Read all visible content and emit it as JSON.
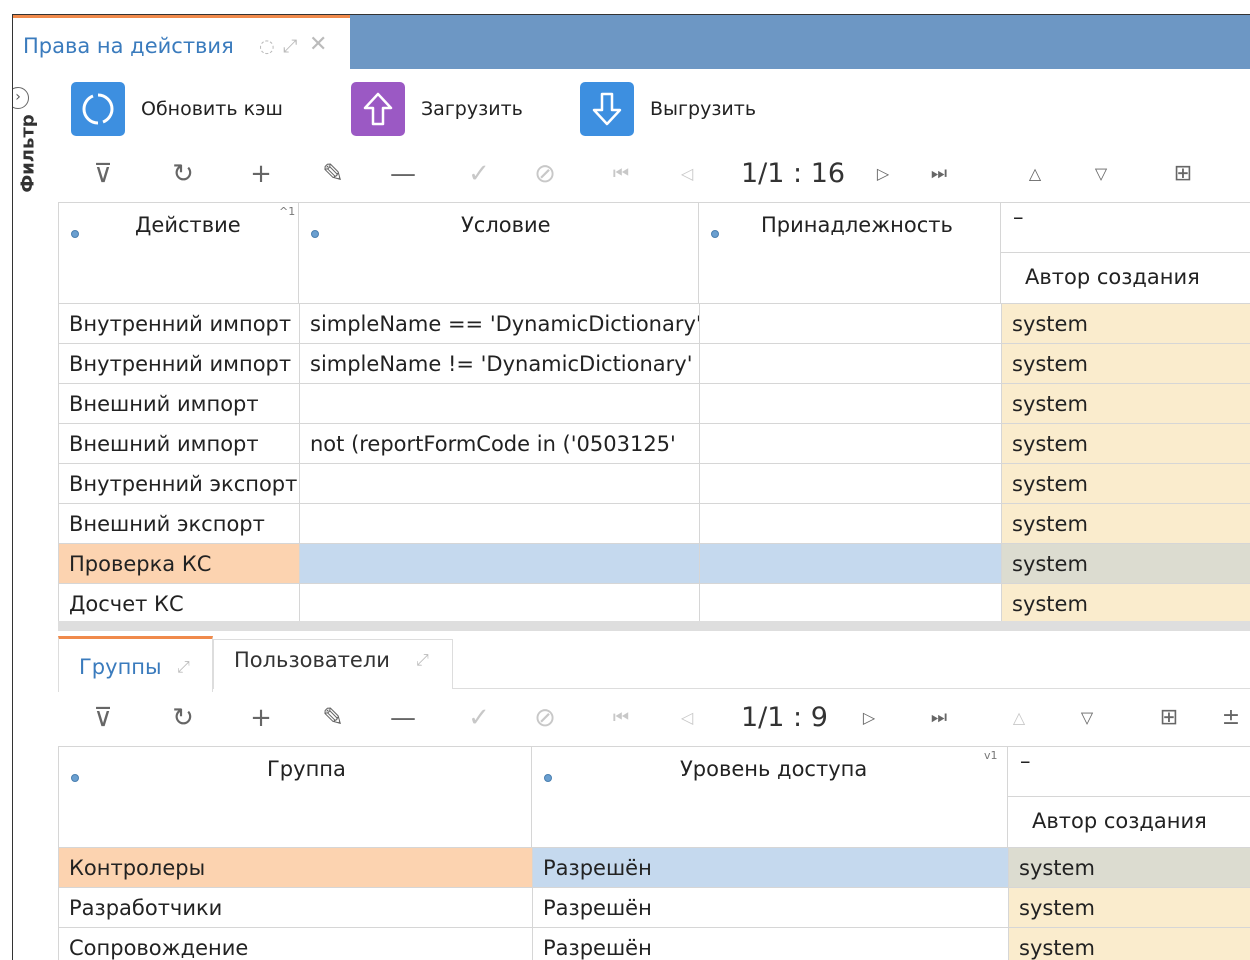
{
  "window": {
    "tab_title": "Права на действия"
  },
  "filter": {
    "label": "Фильтр"
  },
  "toolbar": {
    "refresh_cache": "Обновить кэш",
    "upload": "Загрузить",
    "download": "Выгрузить"
  },
  "grid1": {
    "pager": "1/1 : 16",
    "sort_indicator": "^1",
    "columns": {
      "action": "Действие",
      "condition": "Условие",
      "ownership": "Принадлежность",
      "group_dash": "–",
      "author": "Автор создания"
    },
    "rows": [
      {
        "action": "Внутренний импорт",
        "condition": "simpleName == 'DynamicDictionary'",
        "ownership": "",
        "author": "system"
      },
      {
        "action": "Внутренний импорт",
        "condition": "simpleName != 'DynamicDictionary'",
        "ownership": "",
        "author": "system"
      },
      {
        "action": "Внешний импорт",
        "condition": "",
        "ownership": "",
        "author": "system"
      },
      {
        "action": "Внешний импорт",
        "condition": "not (reportFormCode in ('0503125'",
        "ownership": "",
        "author": "system"
      },
      {
        "action": "Внутренний экспорт",
        "condition": "",
        "ownership": "",
        "author": "system"
      },
      {
        "action": "Внешний экспорт",
        "condition": "",
        "ownership": "",
        "author": "system"
      },
      {
        "action": "Проверка КС",
        "condition": "",
        "ownership": "",
        "author": "system"
      },
      {
        "action": "Досчет КС",
        "condition": "",
        "ownership": "",
        "author": "system"
      }
    ]
  },
  "subtabs": {
    "groups": "Группы",
    "users": "Пользователи"
  },
  "grid2": {
    "pager": "1/1 : 9",
    "sort_indicator": "v1",
    "columns": {
      "group": "Группа",
      "access_level": "Уровень доступа",
      "group_dash": "–",
      "author": "Автор создания"
    },
    "rows": [
      {
        "group": "Контролеры",
        "access_level": "Разрешён",
        "author": "system"
      },
      {
        "group": "Разработчики",
        "access_level": "Разрешён",
        "author": "system"
      },
      {
        "group": "Сопровождение",
        "access_level": "Разрешён",
        "author": "system"
      }
    ]
  },
  "colors": {
    "accent_orange": "#f08a4b",
    "tabbar_blue": "#6d97c4",
    "refresh_btn": "#3d8fe0",
    "upload_btn": "#9b59c4",
    "download_btn": "#3d8fe0",
    "author_bg": "#faeccd",
    "selected_orange": "#fcd3b0",
    "selected_blue": "#c5d9ee"
  }
}
